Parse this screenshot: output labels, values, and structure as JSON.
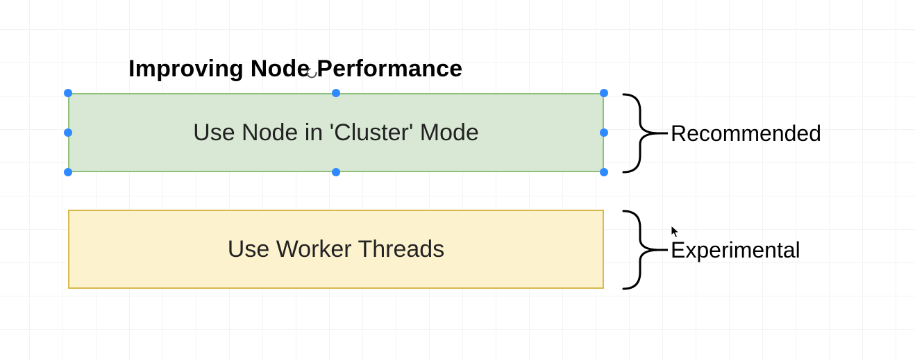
{
  "title": "Improving Node Performance",
  "boxes": [
    {
      "text": "Use Node in 'Cluster' Mode",
      "annotation": "Recommended",
      "selected": true
    },
    {
      "text": "Use Worker Threads",
      "annotation": "Experimental",
      "selected": false
    }
  ],
  "colors": {
    "box1_fill": "#d9e8d4",
    "box1_border": "#8ec07c",
    "box2_fill": "#fcf2ce",
    "box2_border": "#d9b94f",
    "selection_handle": "#2f89ff"
  }
}
